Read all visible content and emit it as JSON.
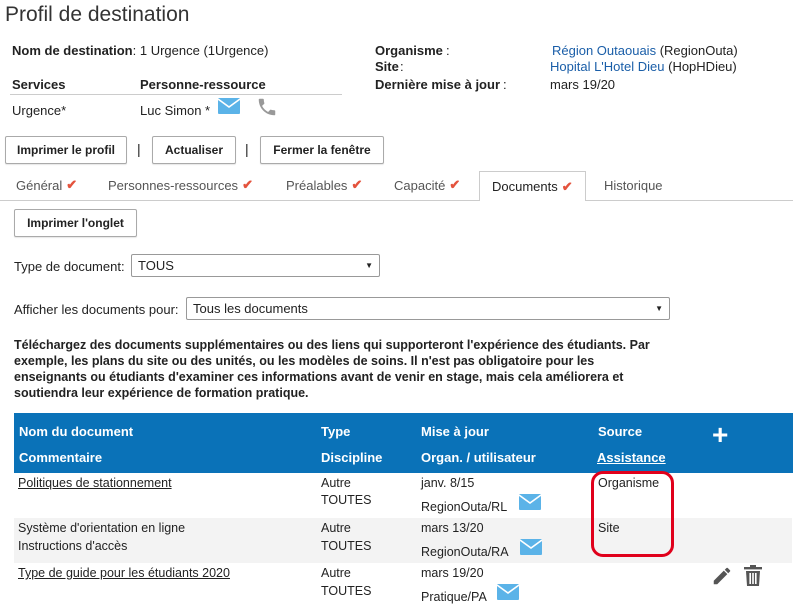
{
  "page": {
    "title": "Profil de destination"
  },
  "info": {
    "destination_label": "Nom de destination",
    "destination_value": ": 1 Urgence (1Urgence)",
    "organisme_label": "Organisme",
    "organisme_colon": ":",
    "organisme_link": "Région Outaouais",
    "organisme_code": " (RegionOuta)",
    "site_label": "Site",
    "site_colon": ":",
    "site_link": "Hopital L'Hotel Dieu",
    "site_code": " (HopHDieu)",
    "update_label": "Dernière mise à jour",
    "update_colon": ":",
    "update_value": "mars 19/20",
    "services_header": "Services",
    "contact_header": "Personne-ressource",
    "service_value": "Urgence*",
    "contact_value": "Luc Simon *"
  },
  "actions": {
    "print_profile": "Imprimer le profil",
    "refresh": "Actualiser",
    "close_window": "Fermer la fenêtre",
    "separator": "|"
  },
  "tabs": [
    {
      "label": "Général",
      "checked": true
    },
    {
      "label": "Personnes-ressources",
      "checked": true
    },
    {
      "label": "Préalables",
      "checked": true
    },
    {
      "label": "Capacité",
      "checked": true
    },
    {
      "label": "Documents",
      "checked": true,
      "active": true
    },
    {
      "label": "Historique",
      "checked": false
    }
  ],
  "check_glyph": "✔",
  "documents": {
    "print_tab": "Imprimer l'onglet",
    "type_label": "Type de document:",
    "type_value": "TOUS",
    "show_for_label": "Afficher les documents pour:",
    "show_for_value": "Tous les documents",
    "instructions": "Téléchargez des documents supplémentaires ou des liens qui supporteront l'expérience des étudiants. Par exemple, les plans du site ou des unités, ou les modèles de soins. Il n'est pas obligatoire pour les enseignants ou étudiants d'examiner ces informations avant de venir en stage, mais cela améliorera et soutiendra leur expérience de formation pratique."
  },
  "table": {
    "headers": {
      "name": "Nom du document",
      "comment": "Commentaire",
      "type": "Type",
      "discipline": "Discipline",
      "updated": "Mise à jour",
      "org_user": "Organ. / utilisateur",
      "source": "Source",
      "assistance": "Assistance",
      "add": "+"
    },
    "rows": [
      {
        "name": "Politiques de stationnement",
        "comment": "",
        "type": "Autre",
        "discipline": "TOUTES",
        "date": "janv. 8/15",
        "org_user": "RegionOuta/RL",
        "source": "Organisme"
      },
      {
        "name": "Système d'orientation en ligne",
        "comment": "Instructions d'accès",
        "type": "Autre",
        "discipline": "TOUTES",
        "date": "mars 13/20",
        "org_user": "RegionOuta/RA",
        "source": "Site"
      },
      {
        "name": "Type de guide pour les étudiants 2020",
        "comment": "",
        "type": "Autre",
        "discipline": "TOUTES",
        "date": "mars 19/20",
        "org_user": "Pratique/PA",
        "source": ""
      }
    ]
  },
  "colors": {
    "header_blue": "#0a72b8",
    "accent_check": "#e4533d",
    "envelope": "#5bb3e8",
    "highlight_red": "#e0001b"
  }
}
